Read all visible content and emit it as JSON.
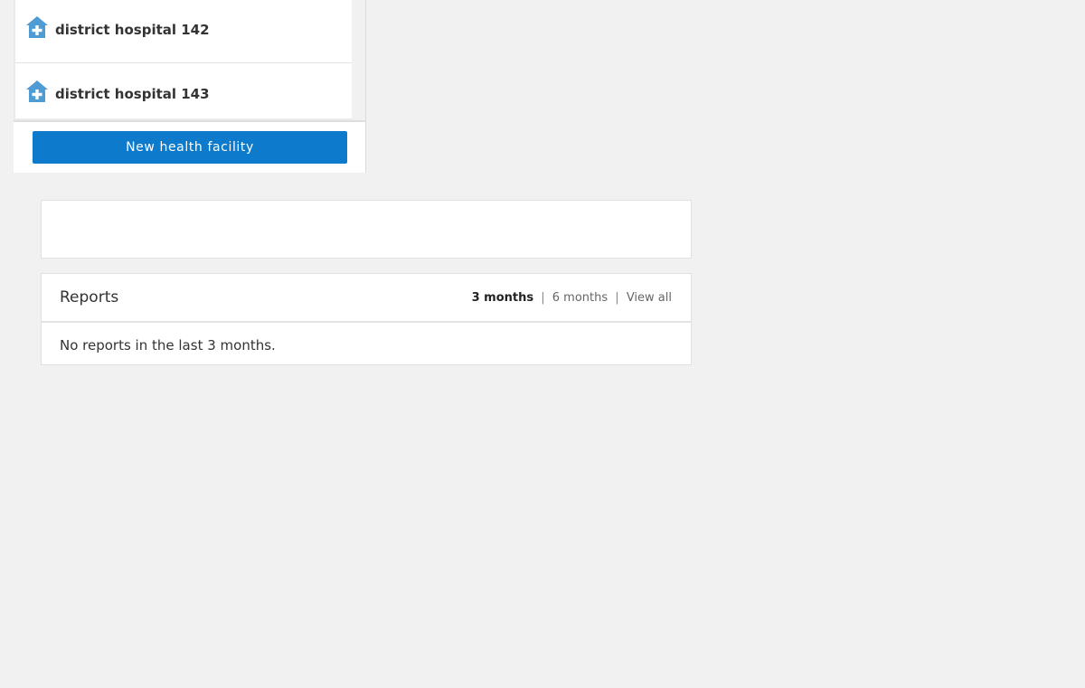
{
  "sidebar": {
    "facilities": [
      {
        "name": "district hospital 142",
        "icon": "health-facility-icon"
      },
      {
        "name": "district hospital 143",
        "icon": "health-facility-icon"
      }
    ],
    "new_button_label": "New health facility"
  },
  "reports": {
    "title": "Reports",
    "ranges": {
      "three_months": "3 months",
      "separator_1": "|",
      "six_months": "6 months",
      "separator_2": "|",
      "view_all": "View all"
    },
    "active_range": "3 months",
    "empty_message": "No reports in the last 3 months."
  },
  "colors": {
    "primary_button": "#0e7acb",
    "icon": "#4f9bd4",
    "background": "#f1f1f1"
  }
}
